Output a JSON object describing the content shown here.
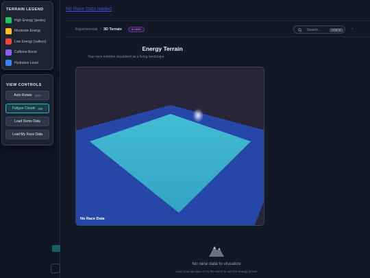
{
  "top_link": "No Race Data loaded",
  "legend": {
    "title": "TERRAIN LEGEND",
    "items": [
      {
        "label": "High Energy (peaks)",
        "color": "#22c55e"
      },
      {
        "label": "Moderate Energy",
        "color": "#fbbf24"
      },
      {
        "label": "Low Energy (valleys)",
        "color": "#ef4444"
      },
      {
        "label": "Caffeine Boost",
        "color": "#8b5cf6"
      },
      {
        "label": "Hydration Level",
        "color": "#3b82f6"
      }
    ]
  },
  "controls": {
    "title": "VIEW CONTROLS",
    "auto_rotate": {
      "label": "Auto Rotate",
      "state": "OFF"
    },
    "fatigue_clouds": {
      "label": "Fatigue Clouds",
      "state": "ON"
    },
    "load_demo": "Load Demo Data",
    "load_race": "Load My Race Data"
  },
  "header": {
    "breadcrumb_parent": "Experimental",
    "breadcrumb_sep": "/",
    "breadcrumb_current": "3D Terrain",
    "badge": "● LABS",
    "search_placeholder": "Search...",
    "search_shortcut": "CTRL+K",
    "menu_dot": "•"
  },
  "page": {
    "title": "Energy Terrain",
    "subtitle": "Your race nutrition visualized as a living landscape"
  },
  "terrain": {
    "label": "No Race Data",
    "colors": {
      "background": "#282539",
      "plane": "#2747a8",
      "surface": "#3bb2d0"
    }
  },
  "empty_state": {
    "icon": "mountain-icon",
    "title": "No race data to visualize",
    "subtitle": "Load your lap data or try the demo to see the energy terrain"
  }
}
